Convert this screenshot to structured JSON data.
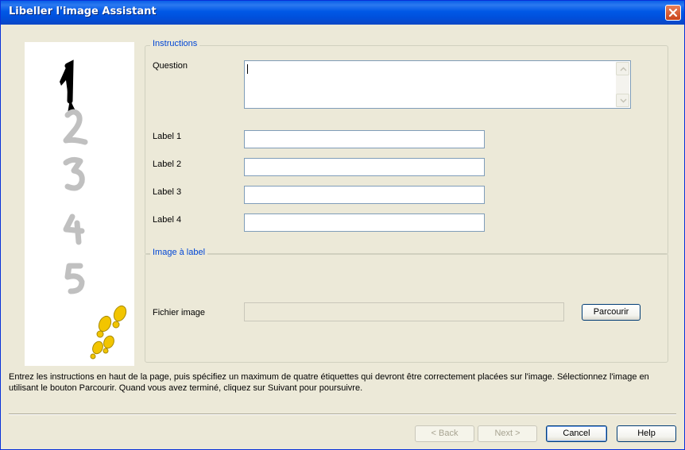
{
  "window": {
    "title": "Libeller l'image Assistant"
  },
  "illustration": {
    "numbers": [
      "1",
      "2",
      "3",
      "4",
      "5"
    ],
    "colors": {
      "active": "#000000",
      "inactive": "#c0c0c0",
      "footprints": "#f2c500"
    }
  },
  "instructions_group": {
    "legend": "Instructions",
    "question_label": "Question",
    "question_value": "",
    "labels": [
      {
        "label": "Label 1",
        "value": ""
      },
      {
        "label": "Label 2",
        "value": ""
      },
      {
        "label": "Label 3",
        "value": ""
      },
      {
        "label": "Label 4",
        "value": ""
      }
    ]
  },
  "image_group": {
    "legend": "Image à label",
    "file_label": "Fichier image",
    "file_value": "",
    "browse_button": "Parcourir"
  },
  "help_text": "Entrez les instructions en haut de la page, puis spécifiez un maximum de quatre étiquettes qui devront être correctement placées sur l'image. Sélectionnez l'image en utilisant le bouton Parcourir. Quand vous avez terminé, cliquez sur Suivant pour poursuivre.",
  "footer": {
    "back": "< Back",
    "next": "Next >",
    "cancel": "Cancel",
    "help": "Help"
  }
}
